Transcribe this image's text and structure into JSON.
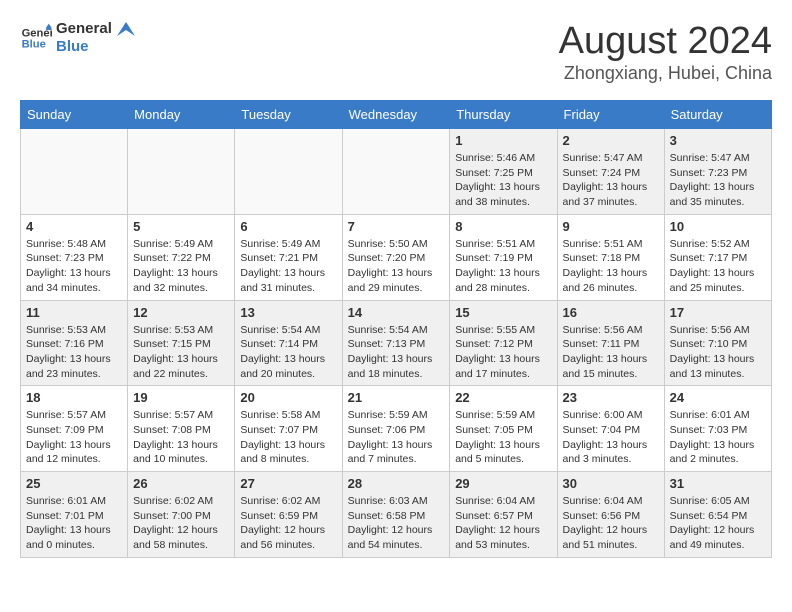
{
  "header": {
    "logo_line1": "General",
    "logo_line2": "Blue",
    "main_title": "August 2024",
    "subtitle": "Zhongxiang, Hubei, China"
  },
  "weekdays": [
    "Sunday",
    "Monday",
    "Tuesday",
    "Wednesday",
    "Thursday",
    "Friday",
    "Saturday"
  ],
  "weeks": [
    [
      {
        "day": "",
        "info": ""
      },
      {
        "day": "",
        "info": ""
      },
      {
        "day": "",
        "info": ""
      },
      {
        "day": "",
        "info": ""
      },
      {
        "day": "1",
        "info": "Sunrise: 5:46 AM\nSunset: 7:25 PM\nDaylight: 13 hours\nand 38 minutes."
      },
      {
        "day": "2",
        "info": "Sunrise: 5:47 AM\nSunset: 7:24 PM\nDaylight: 13 hours\nand 37 minutes."
      },
      {
        "day": "3",
        "info": "Sunrise: 5:47 AM\nSunset: 7:23 PM\nDaylight: 13 hours\nand 35 minutes."
      }
    ],
    [
      {
        "day": "4",
        "info": "Sunrise: 5:48 AM\nSunset: 7:23 PM\nDaylight: 13 hours\nand 34 minutes."
      },
      {
        "day": "5",
        "info": "Sunrise: 5:49 AM\nSunset: 7:22 PM\nDaylight: 13 hours\nand 32 minutes."
      },
      {
        "day": "6",
        "info": "Sunrise: 5:49 AM\nSunset: 7:21 PM\nDaylight: 13 hours\nand 31 minutes."
      },
      {
        "day": "7",
        "info": "Sunrise: 5:50 AM\nSunset: 7:20 PM\nDaylight: 13 hours\nand 29 minutes."
      },
      {
        "day": "8",
        "info": "Sunrise: 5:51 AM\nSunset: 7:19 PM\nDaylight: 13 hours\nand 28 minutes."
      },
      {
        "day": "9",
        "info": "Sunrise: 5:51 AM\nSunset: 7:18 PM\nDaylight: 13 hours\nand 26 minutes."
      },
      {
        "day": "10",
        "info": "Sunrise: 5:52 AM\nSunset: 7:17 PM\nDaylight: 13 hours\nand 25 minutes."
      }
    ],
    [
      {
        "day": "11",
        "info": "Sunrise: 5:53 AM\nSunset: 7:16 PM\nDaylight: 13 hours\nand 23 minutes."
      },
      {
        "day": "12",
        "info": "Sunrise: 5:53 AM\nSunset: 7:15 PM\nDaylight: 13 hours\nand 22 minutes."
      },
      {
        "day": "13",
        "info": "Sunrise: 5:54 AM\nSunset: 7:14 PM\nDaylight: 13 hours\nand 20 minutes."
      },
      {
        "day": "14",
        "info": "Sunrise: 5:54 AM\nSunset: 7:13 PM\nDaylight: 13 hours\nand 18 minutes."
      },
      {
        "day": "15",
        "info": "Sunrise: 5:55 AM\nSunset: 7:12 PM\nDaylight: 13 hours\nand 17 minutes."
      },
      {
        "day": "16",
        "info": "Sunrise: 5:56 AM\nSunset: 7:11 PM\nDaylight: 13 hours\nand 15 minutes."
      },
      {
        "day": "17",
        "info": "Sunrise: 5:56 AM\nSunset: 7:10 PM\nDaylight: 13 hours\nand 13 minutes."
      }
    ],
    [
      {
        "day": "18",
        "info": "Sunrise: 5:57 AM\nSunset: 7:09 PM\nDaylight: 13 hours\nand 12 minutes."
      },
      {
        "day": "19",
        "info": "Sunrise: 5:57 AM\nSunset: 7:08 PM\nDaylight: 13 hours\nand 10 minutes."
      },
      {
        "day": "20",
        "info": "Sunrise: 5:58 AM\nSunset: 7:07 PM\nDaylight: 13 hours\nand 8 minutes."
      },
      {
        "day": "21",
        "info": "Sunrise: 5:59 AM\nSunset: 7:06 PM\nDaylight: 13 hours\nand 7 minutes."
      },
      {
        "day": "22",
        "info": "Sunrise: 5:59 AM\nSunset: 7:05 PM\nDaylight: 13 hours\nand 5 minutes."
      },
      {
        "day": "23",
        "info": "Sunrise: 6:00 AM\nSunset: 7:04 PM\nDaylight: 13 hours\nand 3 minutes."
      },
      {
        "day": "24",
        "info": "Sunrise: 6:01 AM\nSunset: 7:03 PM\nDaylight: 13 hours\nand 2 minutes."
      }
    ],
    [
      {
        "day": "25",
        "info": "Sunrise: 6:01 AM\nSunset: 7:01 PM\nDaylight: 13 hours\nand 0 minutes."
      },
      {
        "day": "26",
        "info": "Sunrise: 6:02 AM\nSunset: 7:00 PM\nDaylight: 12 hours\nand 58 minutes."
      },
      {
        "day": "27",
        "info": "Sunrise: 6:02 AM\nSunset: 6:59 PM\nDaylight: 12 hours\nand 56 minutes."
      },
      {
        "day": "28",
        "info": "Sunrise: 6:03 AM\nSunset: 6:58 PM\nDaylight: 12 hours\nand 54 minutes."
      },
      {
        "day": "29",
        "info": "Sunrise: 6:04 AM\nSunset: 6:57 PM\nDaylight: 12 hours\nand 53 minutes."
      },
      {
        "day": "30",
        "info": "Sunrise: 6:04 AM\nSunset: 6:56 PM\nDaylight: 12 hours\nand 51 minutes."
      },
      {
        "day": "31",
        "info": "Sunrise: 6:05 AM\nSunset: 6:54 PM\nDaylight: 12 hours\nand 49 minutes."
      }
    ]
  ]
}
